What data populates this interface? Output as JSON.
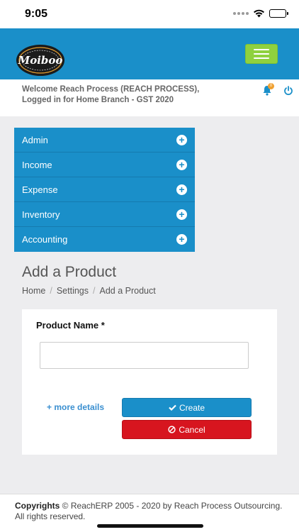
{
  "status_bar": {
    "time": "9:05"
  },
  "app": {
    "logo_text": "Moiboo",
    "menu_icon": "hamburger-icon",
    "accent": "#1a8fc9",
    "toggle_color": "#8fd13f"
  },
  "welcome": {
    "line1": "Welcome Reach Process (REACH PROCESS),",
    "line2": "Logged in for Home Branch - GST 2020",
    "notification_count": "0"
  },
  "sidebar": {
    "items": [
      {
        "label": "Admin",
        "icon": "plus-circle-icon"
      },
      {
        "label": "Income",
        "icon": "plus-circle-icon"
      },
      {
        "label": "Expense",
        "icon": "plus-circle-icon"
      },
      {
        "label": "Inventory",
        "icon": "plus-circle-icon"
      },
      {
        "label": "Accounting",
        "icon": "plus-circle-icon"
      }
    ]
  },
  "page": {
    "title": "Add a Product",
    "breadcrumb": [
      "Home",
      "Settings",
      "Add a Product"
    ]
  },
  "form": {
    "product_name_label": "Product Name *",
    "product_name_value": "",
    "more_details": "+ more details",
    "create_label": "Create",
    "cancel_label": "Cancel",
    "create_color": "#1a8fc9",
    "cancel_color": "#d7151f"
  },
  "footer": {
    "copy_bold": "Copyrights",
    "copy_rest": " © ReachERP 2005 - 2020 by Reach Process Outsourcing. All rights reserved."
  }
}
